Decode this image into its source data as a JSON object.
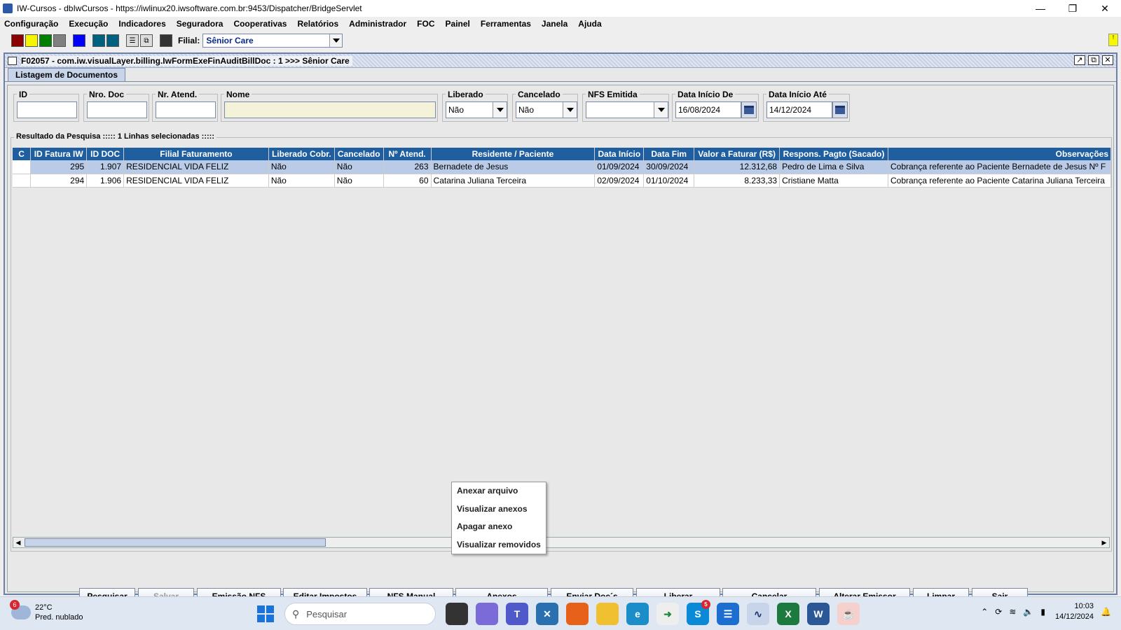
{
  "window": {
    "title": "IW-Cursos - dbIwCursos - https://iwlinux20.iwsoftware.com.br:9453/Dispatcher/BridgeServlet"
  },
  "menu": [
    "Configuração",
    "Execução",
    "Indicadores",
    "Seguradora",
    "Cooperativas",
    "Relatórios",
    "Administrador",
    "FOC",
    "Painel",
    "Ferramentas",
    "Janela",
    "Ajuda"
  ],
  "toolbar": {
    "colors": [
      "#8b0000",
      "#f5f500",
      "#008000",
      "#808080",
      "#0000ff",
      "#00607f",
      "#00607f"
    ],
    "filial_label": "Filial:",
    "filial_value": "Sênior Care",
    "notif": "!"
  },
  "internal_frame": {
    "title": "F02057 - com.iw.visualLayer.billing.IwFormExeFinAuditBillDoc : 1 >>> Sênior Care",
    "tab": "Listagem de Documentos"
  },
  "filters": {
    "id": {
      "label": "ID",
      "value": ""
    },
    "nro_doc": {
      "label": "Nro. Doc",
      "value": ""
    },
    "nr_atend": {
      "label": "Nr. Atend.",
      "value": ""
    },
    "nome": {
      "label": "Nome",
      "value": ""
    },
    "liberado": {
      "label": "Liberado",
      "value": "Não"
    },
    "cancelado": {
      "label": "Cancelado",
      "value": "Não"
    },
    "nfs_emitida": {
      "label": "NFS Emitida",
      "value": ""
    },
    "data_inicio_de": {
      "label": "Data Início De",
      "value": "16/08/2024"
    },
    "data_inicio_ate": {
      "label": "Data Início Até",
      "value": "14/12/2024"
    }
  },
  "results": {
    "label": "Resultado da Pesquisa ::::: 1 Linhas selecionadas :::::",
    "columns": [
      "C",
      "ID Fatura IW",
      "ID DOC",
      "Filial Faturamento",
      "Liberado Cobr.",
      "Cancelado",
      "Nº Atend.",
      "Residente / Paciente",
      "Data Início",
      "Data Fim",
      "Valor a Faturar (R$)",
      "Respons. Pagto (Sacado)",
      "Observações"
    ],
    "rows": [
      [
        "",
        "295",
        "1.907",
        "RESIDENCIAL VIDA FELIZ",
        "Não",
        "Não",
        "263",
        "Bernadete de Jesus",
        "01/09/2024",
        "30/09/2024",
        "12.312,68",
        "Pedro de Lima e Silva",
        "Cobrança referente ao Paciente Bernadete de Jesus  Nº F"
      ],
      [
        "",
        "294",
        "1.906",
        "RESIDENCIAL VIDA FELIZ",
        "Não",
        "Não",
        "60",
        "Catarina Juliana Terceira",
        "02/09/2024",
        "01/10/2024",
        "8.233,33",
        "Cristiane Matta",
        "Cobrança referente ao Paciente Catarina Juliana Terceira"
      ]
    ]
  },
  "popup": [
    "Anexar arquivo",
    "Visualizar anexos",
    "Apagar anexo",
    "Visualizar removidos"
  ],
  "buttons": {
    "pesquisar": "Pesquisar",
    "salvar": "Salvar",
    "emissao_nfs": "Emissão NFS",
    "editar_impostos": "Editar Impostos",
    "nfs_manual": "NFS Manual",
    "anexos": "Anexos",
    "enviar_docs": "Enviar Doc´s",
    "liberar": "Liberar",
    "cancelar": "Cancelar",
    "alterar_emissor": "Alterar Emissor",
    "limpar": "Limpar",
    "sair": "Sair"
  },
  "taskbar": {
    "weather_badge": "6",
    "temp": "22°C",
    "weather": "Pred. nublado",
    "search_placeholder": "Pesquisar",
    "skype_badge": "5",
    "time": "10:03",
    "date": "14/12/2024"
  }
}
